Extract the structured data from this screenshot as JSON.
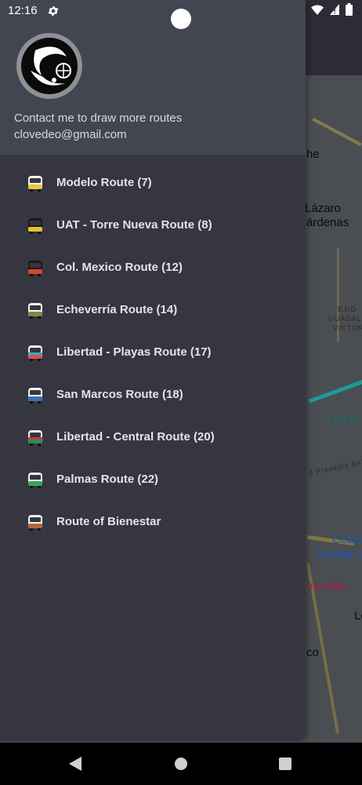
{
  "status_bar": {
    "time": "12:16",
    "icons": [
      "settings-icon",
      "wifi-icon",
      "no-sim-icon",
      "battery-icon"
    ]
  },
  "map": {
    "labels": {
      "l1": "he",
      "l2": "Lázaro",
      "l3": "árdenas",
      "l4": "EJID",
      "l5": "GUADAL",
      "l6": "VICTOR",
      "l7": "Los tu",
      "l8": "d Práxedis Balb",
      "l9": "CeDis",
      "l10": "Ciudad V",
      "l11": "ma Alta",
      "l12": "Lo",
      "l13": "co"
    }
  },
  "drawer": {
    "contact_line1": "Contact me to draw more routes",
    "contact_line2": "clovedeo@gmail.com",
    "items": [
      {
        "label": "Modelo Route (7)",
        "color": "#e9c63f",
        "icon": "bus-icon"
      },
      {
        "label": "UAT - Torre Nueva Route (8)",
        "color": "#e5c02f",
        "icon": "bus-icon"
      },
      {
        "label": "Col. Mexico Route (12)",
        "color": "#d8472f",
        "icon": "bus-icon"
      },
      {
        "label": "Echeverría Route (14)",
        "color": "#7a8a4a",
        "icon": "bus-icon"
      },
      {
        "label": "Libertad - Playas Route (17)",
        "color": "#e24d55",
        "icon": "bus-icon"
      },
      {
        "label": "San Marcos Route (18)",
        "color": "#3b6fb3",
        "icon": "bus-icon"
      },
      {
        "label": "Libertad - Central Route (20)",
        "color": "#2e8a4f",
        "icon": "bus-icon"
      },
      {
        "label": "Palmas Route (22)",
        "color": "#3aa35a",
        "icon": "bus-icon"
      },
      {
        "label": "Route of Bienestar",
        "color": "#b0673a",
        "icon": "bus-icon"
      }
    ]
  },
  "nav_bar": {
    "icons": [
      "back-icon",
      "home-icon",
      "recents-icon"
    ]
  }
}
